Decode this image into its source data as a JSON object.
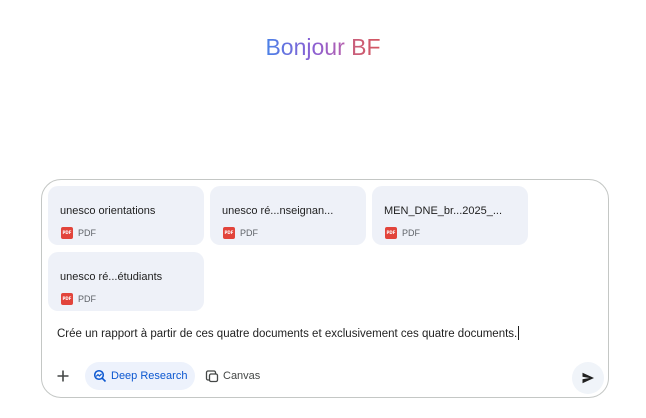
{
  "greeting": {
    "hello": "Bonjour",
    "user": "BF"
  },
  "attachments": [
    {
      "name": "unesco orientations",
      "type": "PDF",
      "icon": "pdf-icon"
    },
    {
      "name": "unesco ré...nseignan...",
      "type": "PDF",
      "icon": "pdf-icon"
    },
    {
      "name": "MEN_DNE_br...2025_...",
      "type": "PDF",
      "icon": "pdf-icon"
    },
    {
      "name": "unesco ré...étudiants",
      "type": "PDF",
      "icon": "pdf-icon"
    }
  ],
  "prompt": {
    "text": "Crée un rapport à partir de ces quatre documents et exclusivement ces quatre documents."
  },
  "toolbar": {
    "add_icon": "plus-icon",
    "deep_research_label": "Deep Research",
    "canvas_label": "Canvas",
    "send_icon": "send-icon"
  },
  "colors": {
    "accent": "#0b57d0",
    "chip_bg": "#eef1f8",
    "pdf_red": "#e2443b",
    "border": "#c4c7c5"
  }
}
